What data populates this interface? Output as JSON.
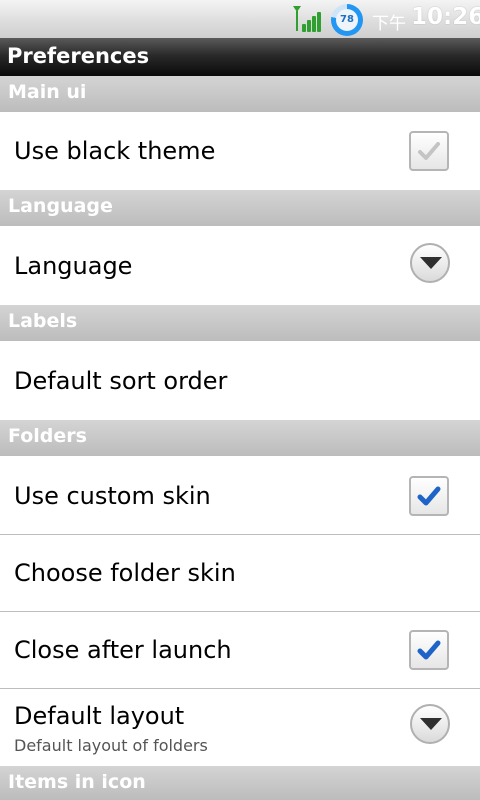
{
  "status_bar": {
    "battery_level": "78",
    "ampm": "下午",
    "time": "10:26"
  },
  "title_bar": {
    "title": "Preferences"
  },
  "sections": [
    {
      "header": "Main ui"
    },
    {
      "header": "Language"
    },
    {
      "header": "Labels"
    },
    {
      "header": "Folders"
    },
    {
      "header": "Items in icon"
    }
  ],
  "preferences": {
    "use_black_theme": {
      "label": "Use black theme",
      "checked": false
    },
    "language": {
      "label": "Language"
    },
    "default_sort_order": {
      "label": "Default sort order"
    },
    "use_custom_skin": {
      "label": "Use custom skin",
      "checked": true
    },
    "choose_folder_skin": {
      "label": "Choose folder skin"
    },
    "close_after_launch": {
      "label": "Close after launch",
      "checked": true
    },
    "default_layout": {
      "label": "Default layout",
      "summary": "Default layout of folders"
    }
  },
  "colors": {
    "check_active": "#1e64c8",
    "check_inactive": "#c4c4c4",
    "signal": "#2fa02f",
    "battery": "#2196f3"
  },
  "icons": {
    "signal": "signal-icon",
    "battery": "battery-icon",
    "checkbox": "checkbox-icon",
    "dropdown": "chevron-down-icon"
  }
}
